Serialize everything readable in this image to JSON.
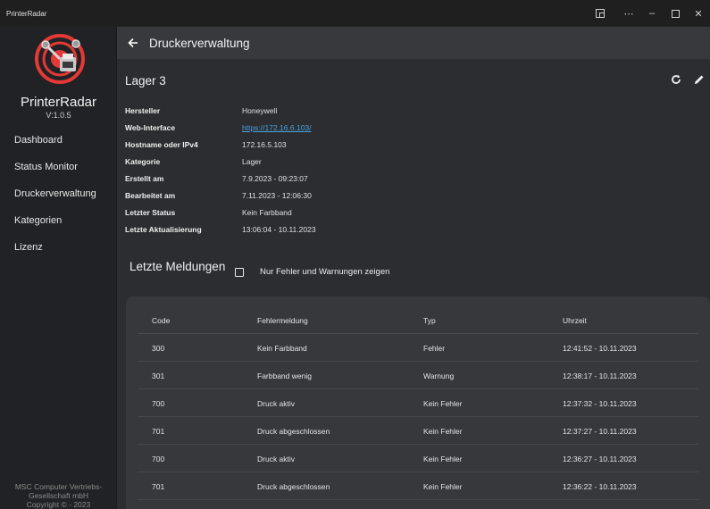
{
  "window": {
    "title": "PrinterRadar"
  },
  "sidebar": {
    "brand": "PrinterRadar",
    "version": "V:1.0.5",
    "items": [
      {
        "label": "Dashboard"
      },
      {
        "label": "Status Monitor"
      },
      {
        "label": "Druckerverwaltung"
      },
      {
        "label": "Kategorien"
      },
      {
        "label": "Lizenz"
      }
    ],
    "footer": [
      "MSC Computer Vertriebs-",
      "Gesellschaft mbH",
      "Copyright © - 2023"
    ]
  },
  "appbar": {
    "title": "Druckerverwaltung"
  },
  "printer": {
    "name": "Lager 3",
    "details": [
      {
        "label": "Hersteller",
        "value": "Honeywell"
      },
      {
        "label": "Web-Interface",
        "value": "https://172.16.6.103/"
      },
      {
        "label": "Hostname oder IPv4",
        "value": "172.16.5.103"
      },
      {
        "label": "Kategorie",
        "value": "Lager"
      },
      {
        "label": "Erstellt am",
        "value": "7.9.2023 - 09:23:07"
      },
      {
        "label": "Bearbeitet am",
        "value": "7.11.2023 - 12:06:30"
      },
      {
        "label": "Letzter Status",
        "value": "Kein Farbband"
      },
      {
        "label": "Letzte Aktualisierung",
        "value": "13:06:04 - 10.11.2023"
      }
    ]
  },
  "messages": {
    "title": "Letzte Meldungen",
    "filter_label": "Nur Fehler und Warnungen zeigen",
    "filter_checked": false,
    "columns": [
      "Code",
      "Fehlermeldung",
      "Typ",
      "Uhrzeit"
    ],
    "rows": [
      [
        "300",
        "Kein Farbband",
        "Fehler",
        "12:41:52 - 10.11.2023"
      ],
      [
        "301",
        "Farbband wenig",
        "Warnung",
        "12:38:17 - 10.11.2023"
      ],
      [
        "700",
        "Druck aktiv",
        "Kein Fehler",
        "12:37:32 - 10.11.2023"
      ],
      [
        "701",
        "Druck abgeschlossen",
        "Kein Fehler",
        "12:37:27 - 10.11.2023"
      ],
      [
        "700",
        "Druck aktiv",
        "Kein Fehler",
        "12:36:27 - 10.11.2023"
      ],
      [
        "701",
        "Druck abgeschlossen",
        "Kein Fehler",
        "12:36:22 - 10.11.2023"
      ]
    ]
  },
  "colors": {
    "accent": "#e53935",
    "link": "#4aa3df"
  }
}
